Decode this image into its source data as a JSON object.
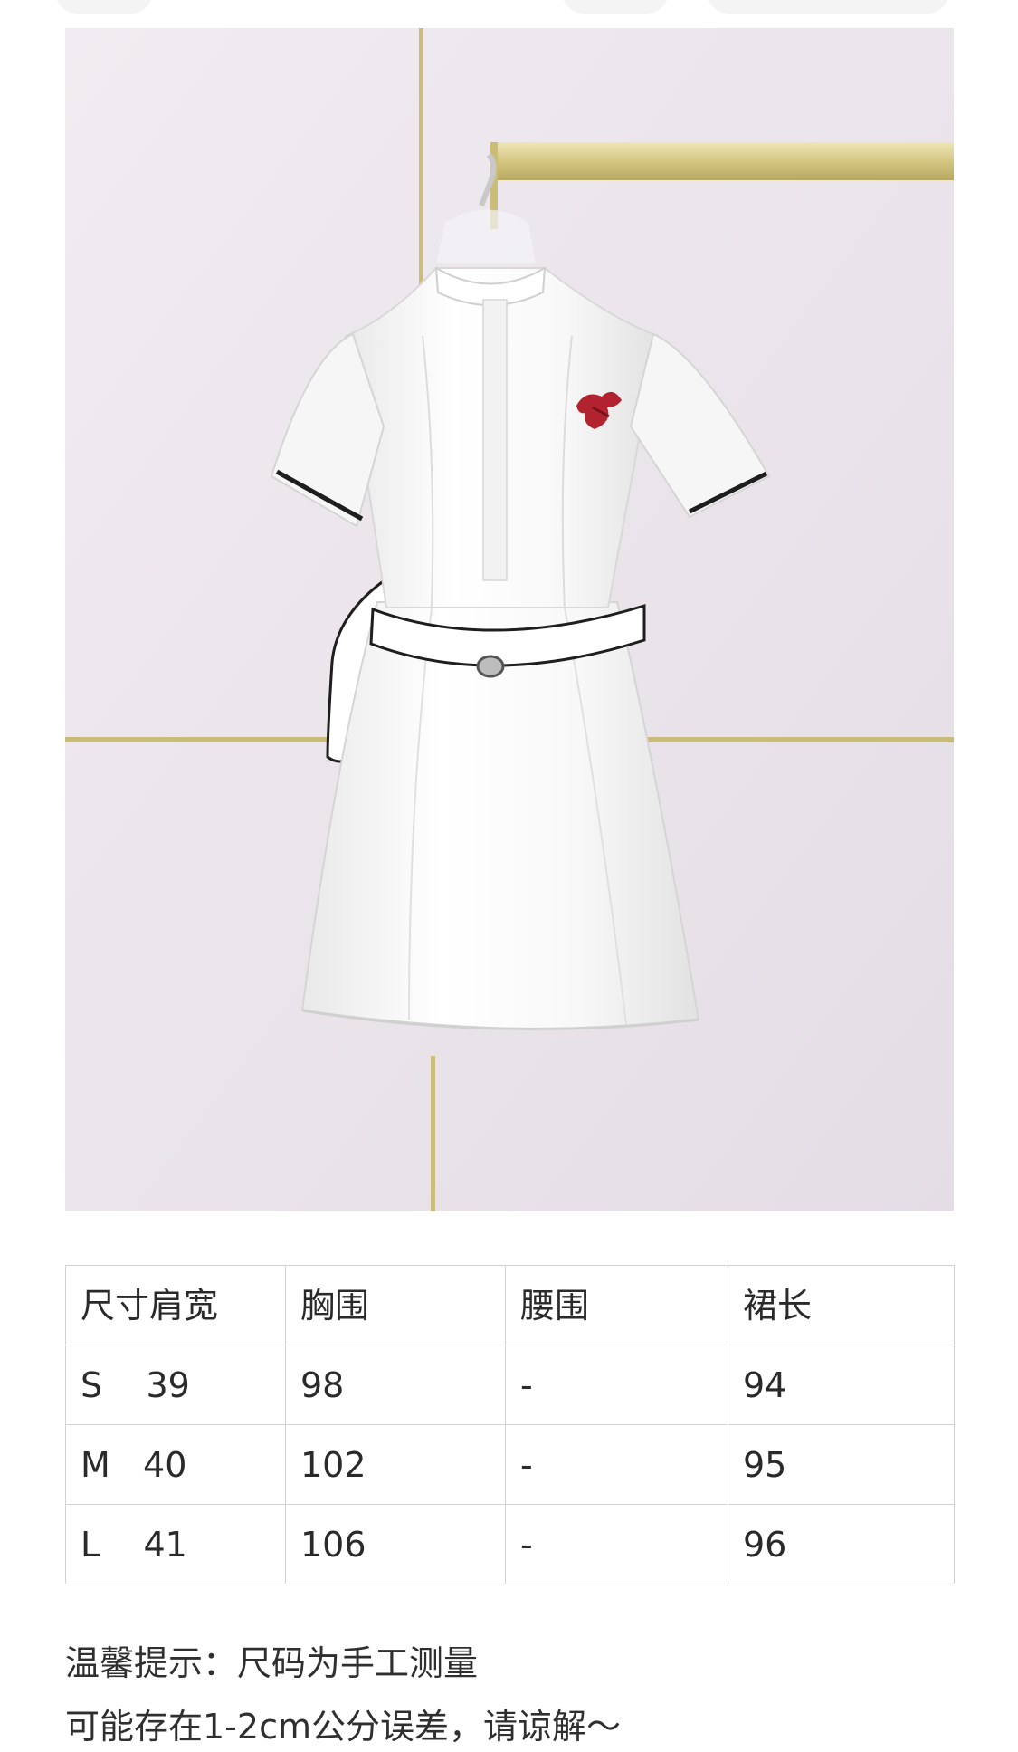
{
  "product_image": {
    "alt": ""
  },
  "size_table": {
    "headers": [
      "尺寸肩宽",
      "胸围",
      "腰围",
      "裙长"
    ],
    "rows": [
      [
        "S    39",
        "98",
        "-",
        "94"
      ],
      [
        "M   40",
        "102",
        "-",
        "95"
      ],
      [
        "L    41",
        "106",
        "-",
        "96"
      ]
    ]
  },
  "notice": {
    "line1": "温馨提示：尺码为手工测量",
    "line2": "可能存在1-2cm公分误差，请谅解～"
  },
  "colors": {
    "wall": "#ece6ec",
    "rail": "#d8c98a",
    "dress": "#fbfbfb",
    "trim": "#1e1e1e",
    "logo": "#b3232f",
    "table_border": "#d2d2d2"
  }
}
